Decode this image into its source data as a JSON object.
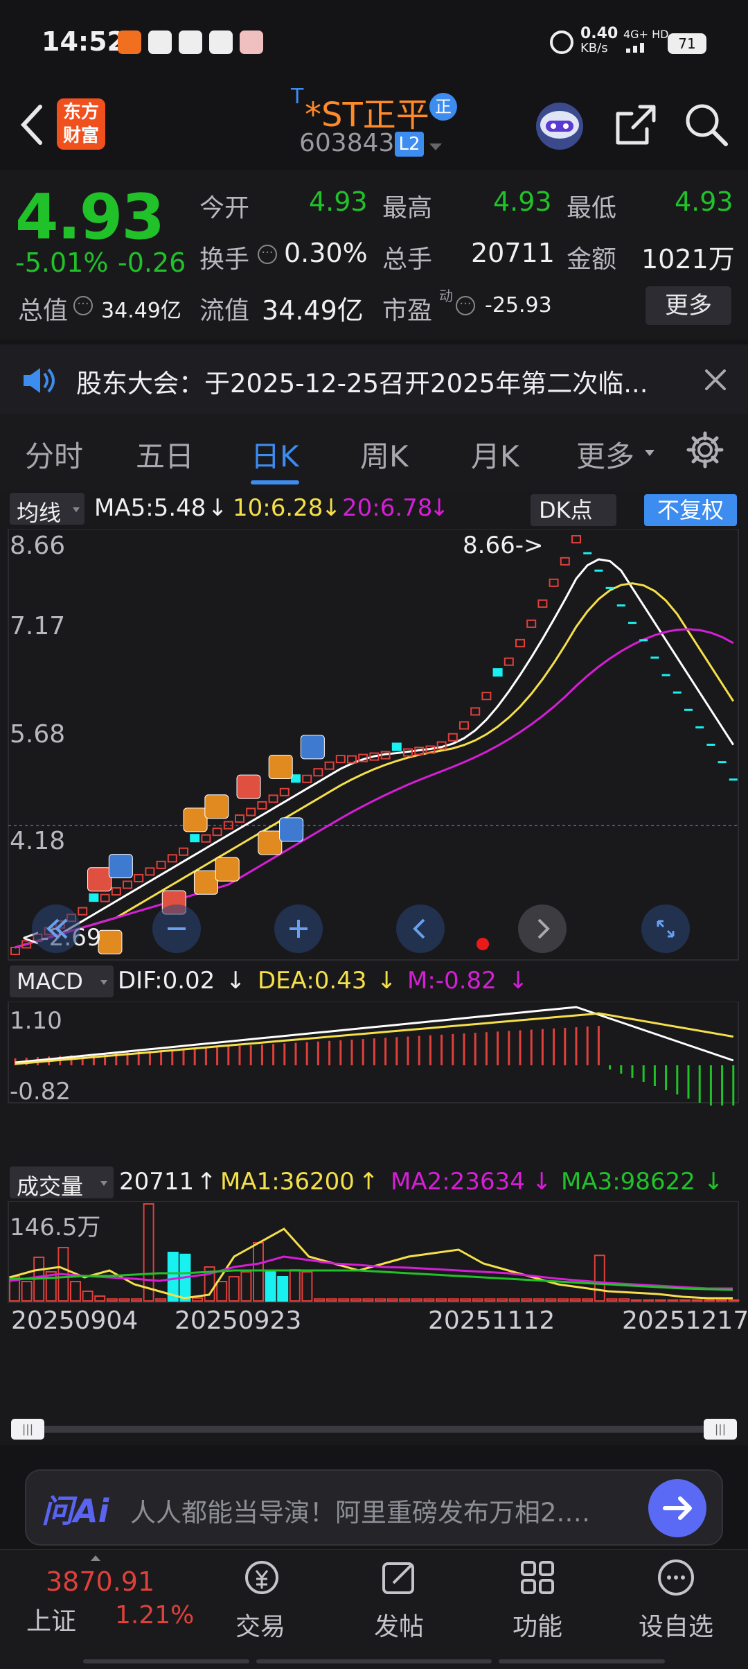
{
  "status": {
    "time": "14:52",
    "net_speed": "0.40",
    "net_unit": "KB/s",
    "net_type": "4G+ HD",
    "battery": "71"
  },
  "header": {
    "logo_line1": "东方",
    "logo_line2": "财富",
    "title_prefix": "T",
    "title": "*ST正平",
    "badge": "正",
    "code": "603843",
    "level": "L2"
  },
  "quote": {
    "price": "4.93",
    "change_pct": "-5.01%",
    "change": "-0.26",
    "open_label": "今开",
    "open": "4.93",
    "high_label": "最高",
    "high": "4.93",
    "low_label": "最低",
    "low": "4.93",
    "turnover_label": "换手",
    "turnover": "0.30%",
    "volume_label": "总手",
    "volume": "20711",
    "amount_label": "金额",
    "amount": "1021万",
    "mktcap_label": "总值",
    "mktcap": "34.49亿",
    "float_label": "流值",
    "float": "34.49亿",
    "pe_label": "市盈",
    "pe_sup": "动",
    "pe": "-25.93",
    "more_button": "更多"
  },
  "notice": {
    "text": "股东大会：于2025-12-25召开2025年第二次临..."
  },
  "tabs": [
    "分时",
    "五日",
    "日K",
    "周K",
    "月K",
    "更多"
  ],
  "active_tab": "日K",
  "kline": {
    "indicator": "均线",
    "ma5": "MA5:5.48",
    "ma10": "10:6.28",
    "ma20": "20:6.78",
    "arrow": "↓",
    "dk_button": "DK点",
    "adjust_button": "不复权",
    "price_ticks": [
      "8.66",
      "7.17",
      "5.68",
      "4.18",
      "2.69"
    ],
    "max_label": "8.66->",
    "min_label": "<-2.69"
  },
  "macd": {
    "indicator": "MACD",
    "dif": "DIF:0.02",
    "dea": "DEA:0.43",
    "m": "M:-0.82",
    "arrow": "↓",
    "ticks": [
      "1.10",
      "-0.82"
    ]
  },
  "volume": {
    "indicator": "成交量",
    "value": "20711",
    "up": "↑",
    "ma1": "MA1:36200",
    "ma2": "MA2:23634",
    "ma3": "MA3:98622",
    "down": "↓",
    "tick": "146.5万"
  },
  "dates": [
    "20250904",
    "20250923",
    "20251112",
    "20251217"
  ],
  "ai": {
    "logo": "问Ai",
    "text": "人人都能当导演！阿里重磅发布万相2.…"
  },
  "bottom": {
    "index_value": "3870.91",
    "index_name": "上证",
    "index_change": "1.21%",
    "items": [
      "交易",
      "发帖",
      "功能",
      "设自选"
    ]
  },
  "colors": {
    "up": "#e0403a",
    "down": "#21c229",
    "ma5": "#ffffff",
    "ma10": "#f5e04a",
    "ma20": "#d61ed6",
    "cyan": "#19f0f0",
    "accent": "#3d8cf0"
  }
}
